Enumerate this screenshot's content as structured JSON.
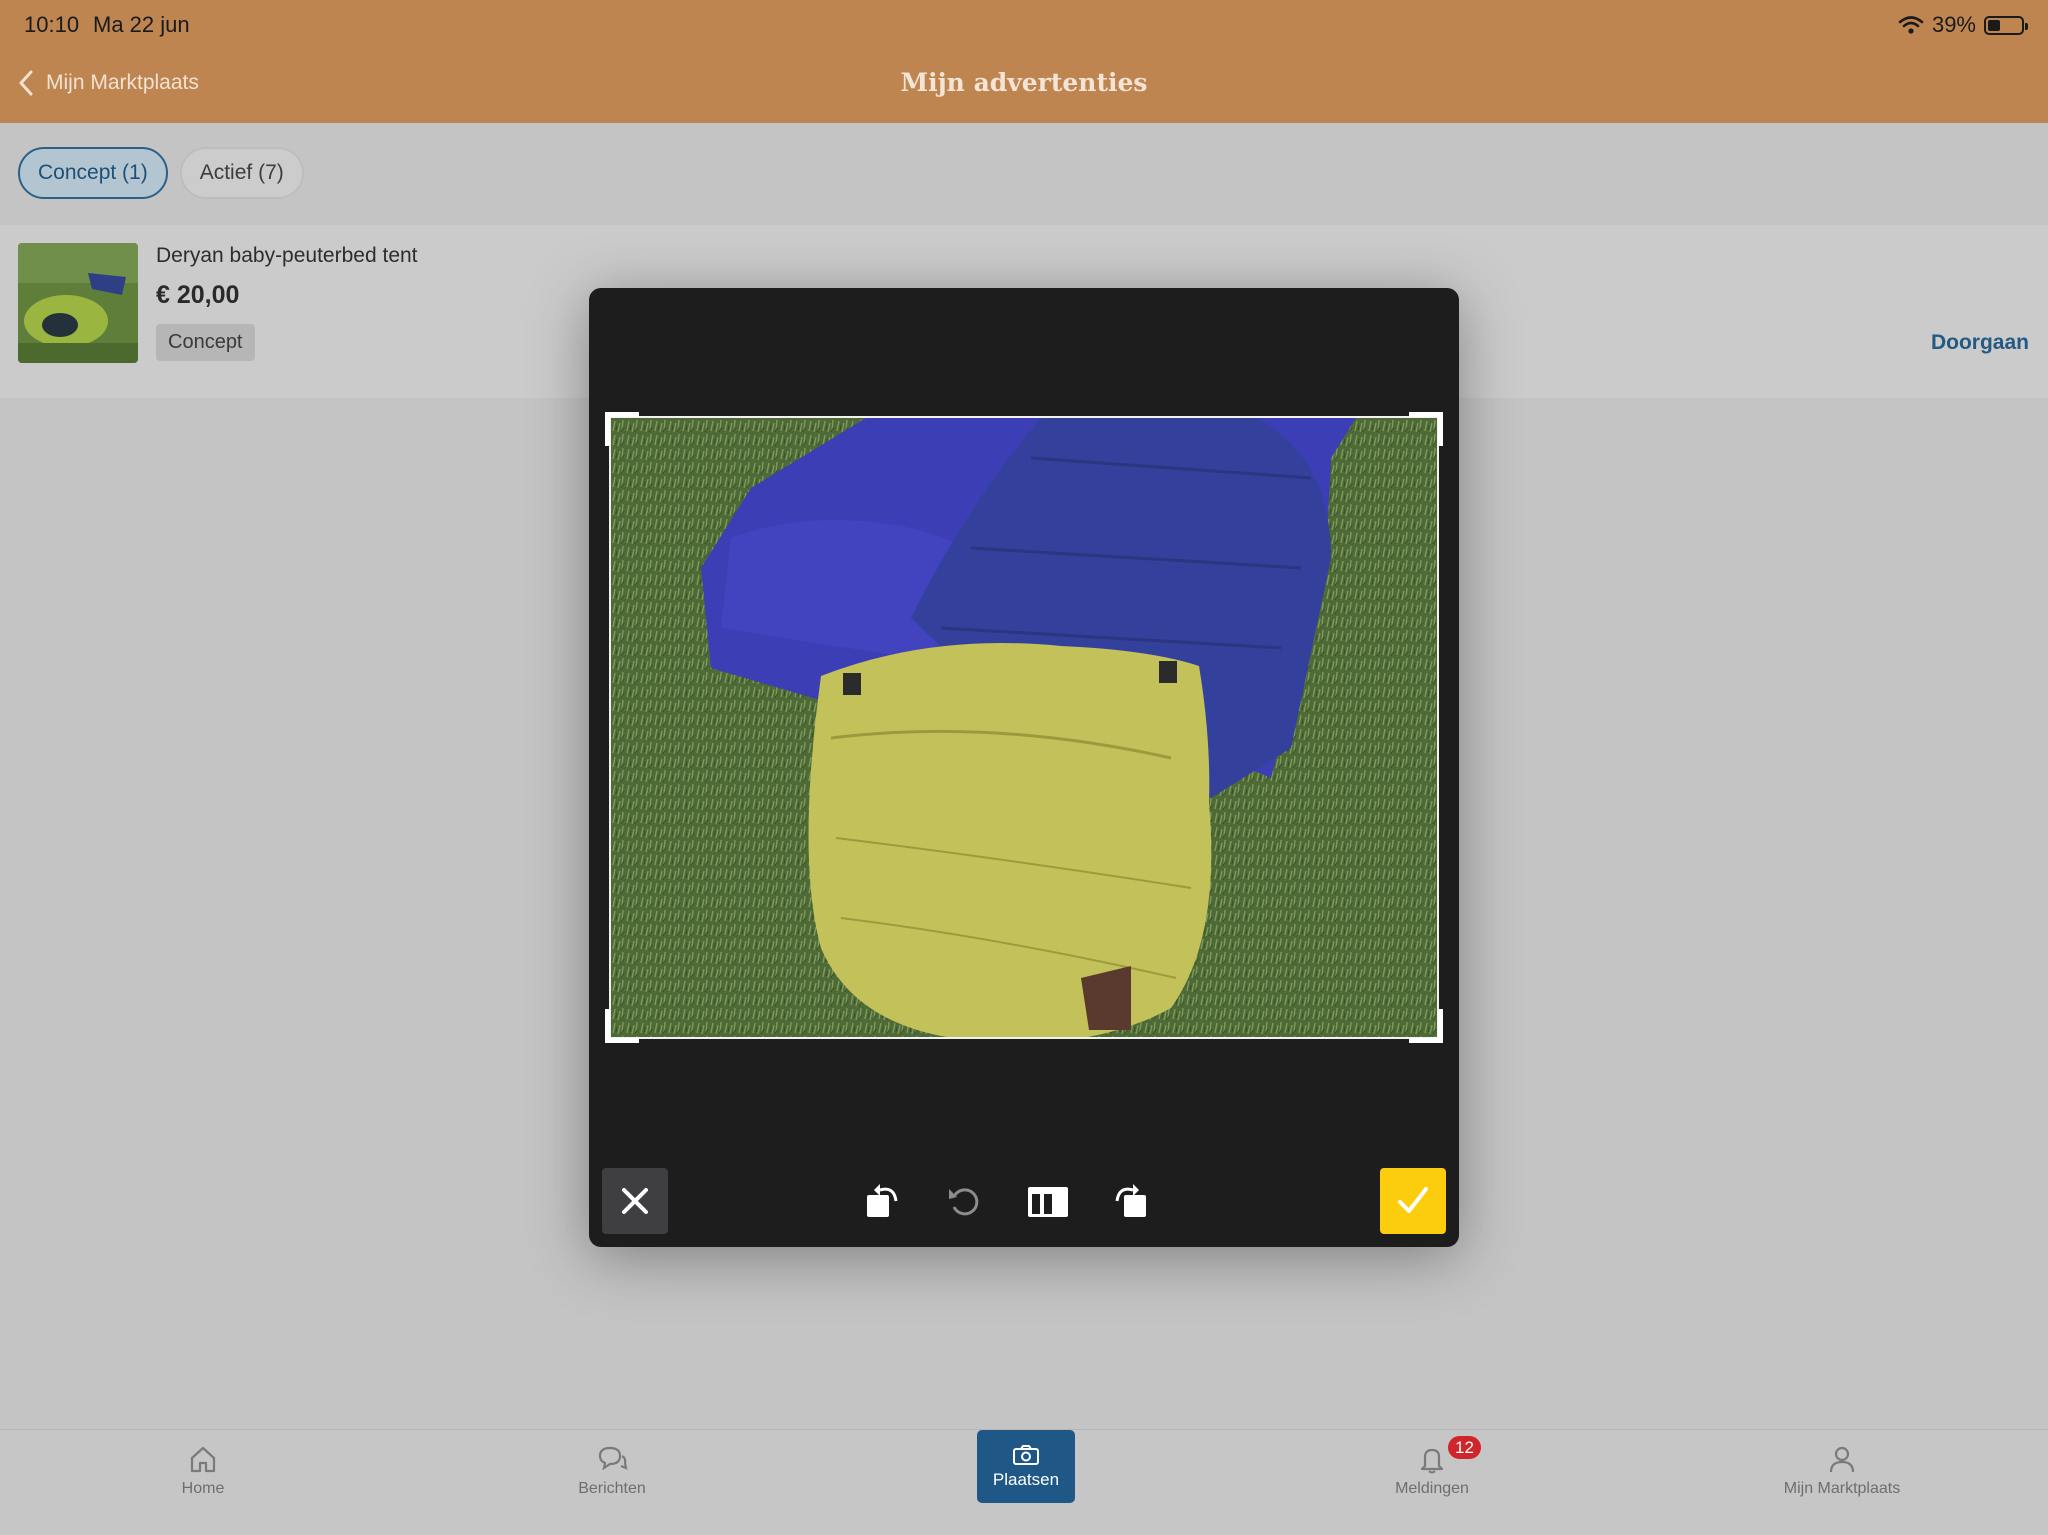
{
  "status_bar": {
    "time": "10:10",
    "date": "Ma 22 jun",
    "battery": "39%",
    "battery_level": 0.39
  },
  "header": {
    "back_label": "Mijn Marktplaats",
    "title": "Mijn advertenties"
  },
  "tabs": [
    {
      "label": "Concept (1)",
      "active": true
    },
    {
      "label": "Actief (7)",
      "active": false
    }
  ],
  "listing": {
    "title": "Deryan baby-peuterbed tent",
    "price": "€ 20,00",
    "badge": "Concept",
    "action": "Doorgaan"
  },
  "editor": {
    "toolbar": [
      "close-icon",
      "rotate-left-icon",
      "reset-icon",
      "aspect-ratio-icon",
      "rotate-right-icon",
      "check-icon"
    ],
    "confirm_color": "#fccd0c"
  },
  "bottom_nav": {
    "home": "Home",
    "messages": "Berichten",
    "place": "Plaatsen",
    "notifications": "Meldingen",
    "notifications_count": "12",
    "account": "Mijn Marktplaats"
  },
  "colors": {
    "header": "#bf8551",
    "accent": "#1f5887",
    "badge": "#d0252b"
  }
}
